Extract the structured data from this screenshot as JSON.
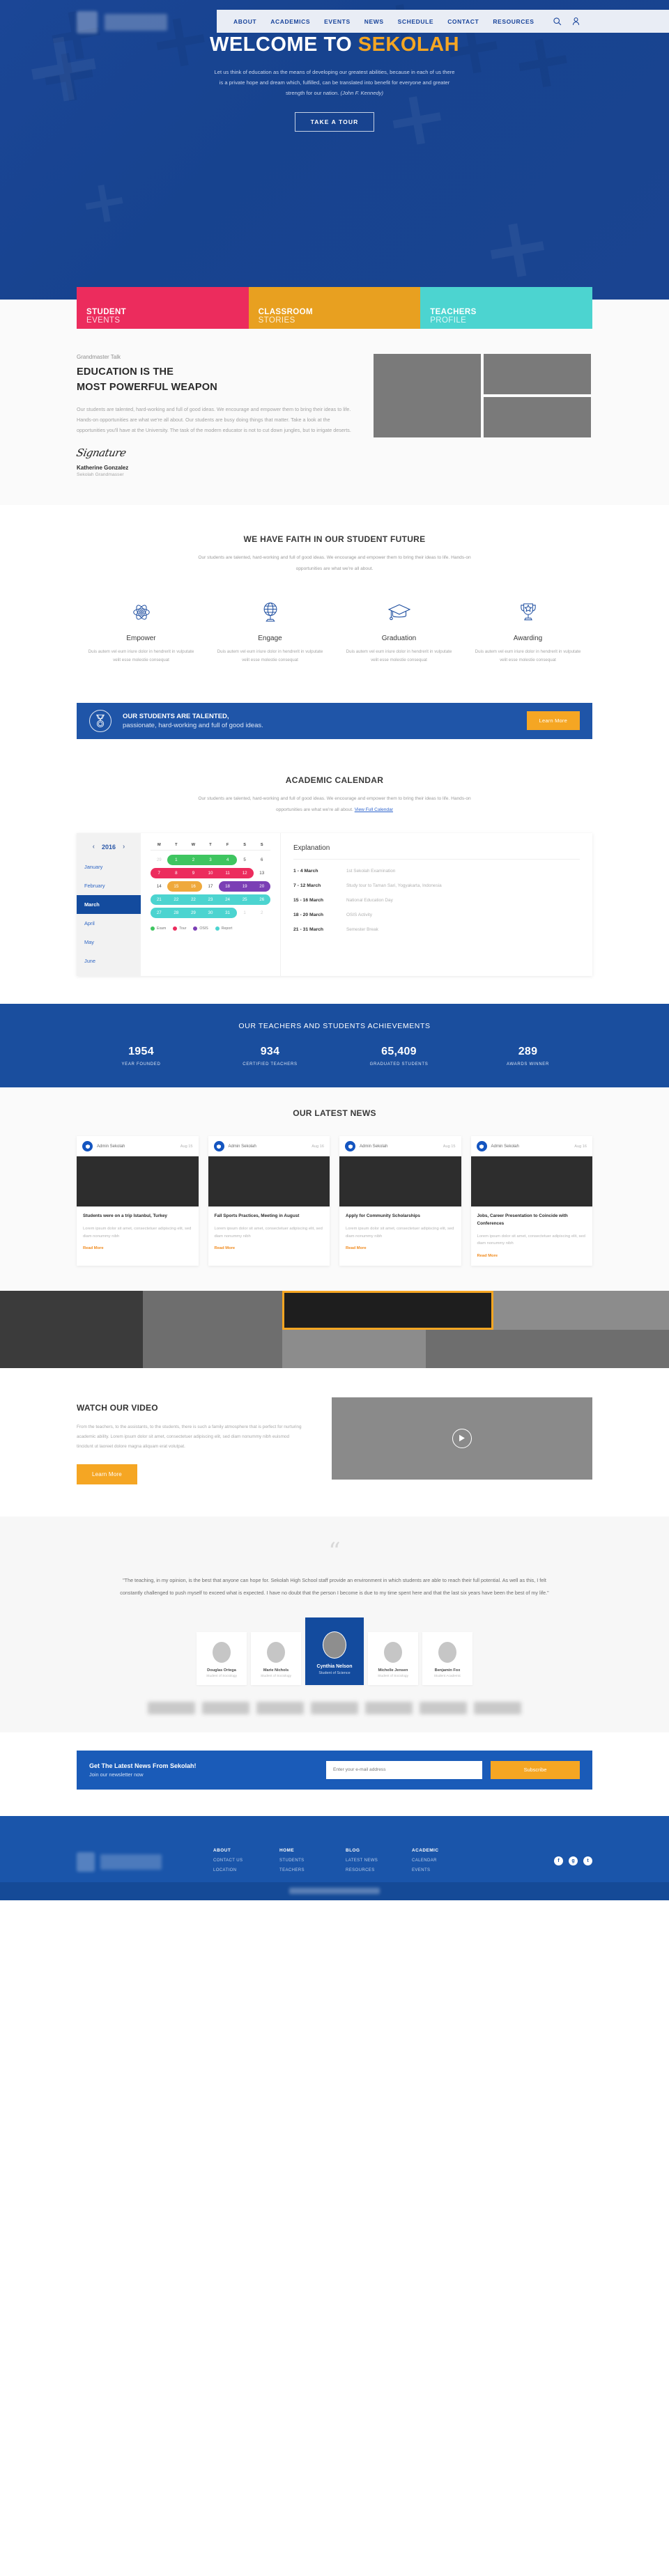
{
  "nav": {
    "items": [
      "ABOUT",
      "ACADEMICS",
      "EVENTS",
      "NEWS",
      "SCHEDULE",
      "CONTACT",
      "RESOURCES"
    ],
    "search_icon": "search-icon",
    "account_icon": "user-icon"
  },
  "hero": {
    "title_plain": "WELCOME TO ",
    "title_accent": "SEKOLAH",
    "paragraph": "Let us think of education as the means of developing our greatest abilities, because in each of us there is a private hope and dream which, fulfilled, can be translated into benefit for everyone and greater strength for our nation. ",
    "attribution": "(John F. Kennedy)",
    "cta": "TAKE A TOUR"
  },
  "cards3": [
    {
      "top": "STUDENT",
      "bottom": "EVENTS",
      "color": "#ec2c5d"
    },
    {
      "top": "CLASSROOM",
      "bottom": "STORIES",
      "color": "#e8a020"
    },
    {
      "top": "TEACHERS",
      "bottom": "PROFILE",
      "color": "#4cd4d0"
    }
  ],
  "grandmaster": {
    "eyebrow": "Grandmaster Talk",
    "title_line1": "EDUCATION IS THE",
    "title_line2": "MOST POWERFUL WEAPON",
    "body": "Our students are talented, hard-working and full of good ideas. We encourage and empower them to bring their ideas to life. Hands-on opportunities are what we're all about. Our students are busy doing things that matter. Take a look at the opportunities you'll have at the University. The task of the modern educator is not to cut down jungles, but to irrigate deserts.",
    "signature": "Signature",
    "name": "Katherine Gonzalez",
    "role": "Sekolah Grandmasser"
  },
  "faith": {
    "title": "WE HAVE FAITH IN OUR STUDENT FUTURE",
    "subtitle": "Our students are talented, hard-working and full of good ideas. We encourage and empower them to bring their ideas to life. Hands-on opportunities are what we're all about.",
    "features": [
      {
        "icon": "atom-icon",
        "name": "Empower",
        "desc": "Duis autem vel eum iriure dolor in hendrerit in vulputate velit esse molestie consequat"
      },
      {
        "icon": "globe-icon",
        "name": "Engage",
        "desc": "Duis autem vel eum iriure dolor in hendrerit in vulputate velit esse molestie consequat"
      },
      {
        "icon": "graduation-cap-icon",
        "name": "Graduation",
        "desc": "Duis autem vel eum iriure dolor in hendrerit in vulputate velit esse molestie consequat"
      },
      {
        "icon": "trophy-icon",
        "name": "Awarding",
        "desc": "Duis autem vel eum iriure dolor in hendrerit in vulputate velit esse molestie consequat"
      }
    ]
  },
  "talented": {
    "icon": "medal-icon",
    "line1": "OUR STUDENTS ARE TALENTED,",
    "line2": "passionate, hard-working and full of good ideas.",
    "button": "Learn More"
  },
  "calendar": {
    "title": "ACADEMIC CALENDAR",
    "subtitle": "Our students are talented, hard-working and full of good ideas. We encourage and empower them to bring their ideas to life. Hands-on opportunities are what we're all about. ",
    "link": "View Full Calendar",
    "year": "2016",
    "prev_icon": "chevron-left-icon",
    "next_icon": "chevron-right-icon",
    "months": [
      "January",
      "February",
      "March",
      "April",
      "May",
      "June"
    ],
    "active_month": "March",
    "dow": [
      "M",
      "T",
      "W",
      "T",
      "F",
      "S",
      "S"
    ],
    "weeks": [
      [
        "29",
        "1",
        "2",
        "3",
        "4",
        "5",
        "6"
      ],
      [
        "7",
        "8",
        "9",
        "10",
        "11",
        "12",
        "13"
      ],
      [
        "14",
        "15",
        "16",
        "17",
        "18",
        "19",
        "20"
      ],
      [
        "21",
        "22",
        "22",
        "23",
        "24",
        "25",
        "26"
      ],
      [
        "27",
        "28",
        "29",
        "30",
        "31",
        "1",
        "2"
      ]
    ],
    "legend": [
      {
        "label": "Exam",
        "color": "#3fc560"
      },
      {
        "label": "Tour",
        "color": "#ec2c5d"
      },
      {
        "label": "OSIS",
        "color": "#7b3fb5"
      },
      {
        "label": "Report",
        "color": "#4cd4d0"
      }
    ],
    "explanation_title": "Explanation",
    "explanations": [
      {
        "date": "1 - 4 March",
        "desc": "1st Sekolah Examination"
      },
      {
        "date": "7 - 12 March",
        "desc": "Study tour to Taman Sari, Yogyakarta, Indonesia"
      },
      {
        "date": "15 - 16 March",
        "desc": "National Education Day"
      },
      {
        "date": "18 - 20 March",
        "desc": "OSIS Activity"
      },
      {
        "date": "21 - 31 March",
        "desc": "Semester Break"
      }
    ]
  },
  "achievements": {
    "title": "OUR TEACHERS AND STUDENTS ACHIEVEMENTS",
    "items": [
      {
        "number": "1954",
        "label": "YEAR FOUNDED"
      },
      {
        "number": "934",
        "label": "CERTIFIED TEACHERS"
      },
      {
        "number": "65,409",
        "label": "GRADUATED STUDENTS"
      },
      {
        "number": "289",
        "label": "AWARDS WINNER"
      }
    ]
  },
  "news": {
    "title": "OUR LATEST NEWS",
    "read_more": "Read More",
    "cards": [
      {
        "author": "Admin Sekolah",
        "date": "Aug 15",
        "title": "Students were on a trip Istanbul, Turkey",
        "desc": "Lorem ipsum dolor sit amet, consectetuer adipiscing elit, sed diam nonummy nibh"
      },
      {
        "author": "Admin Sekolah",
        "date": "Aug 16",
        "title": "Fall Sports Practices, Meeting in August",
        "desc": "Lorem ipsum dolor sit amet, consectetuer adipiscing elit, sed diam nonummy nibh"
      },
      {
        "author": "Admin Sekolah",
        "date": "Aug 15",
        "title": "Apply for Community Scholarships",
        "desc": "Lorem ipsum dolor sit amet, consectetuer adipiscing elit, sed diam nonummy nibh"
      },
      {
        "author": "Admin Sekolah",
        "date": "Aug 16",
        "title": "Jobs, Career Presentation to Coincide with Conferences",
        "desc": "Lorem ipsum dolor sit amet, consectetuer adipiscing elit, sed diam nonummy nibh"
      }
    ]
  },
  "video": {
    "title": "WATCH OUR VIDEO",
    "desc": "From the teachers, to the assistants, to the students, there is such a family atmosphere that is perfect for nurturing academic ability. Lorem ipsum dolor sit amet, consectetuer adipiscing elit, sed diam nonummy nibh euismod tincidunt ut laoreet dolore magna aliquam erat volutpat.",
    "button": "Learn More",
    "play_icon": "play-icon"
  },
  "testimonial": {
    "quote_icon": "quote-icon",
    "text": "\"The teaching, in my opinion, is the best that anyone can hope for. Sekolah High School staff provide an environment in which students are able to reach their full potential. As well as this, I felt constantly challenged to push myself to exceed what is expected. I have no doubt that the person I become is due to my time spent here and that the last six years have been the best of my life.\"",
    "people": [
      {
        "name": "Douglas Ortega",
        "role": "Student of Sociology",
        "active": false
      },
      {
        "name": "Marie Nichols",
        "role": "Student of Sociology",
        "active": false
      },
      {
        "name": "Cynthia Nelson",
        "role": "Student of Science",
        "active": true
      },
      {
        "name": "Michelle Jensen",
        "role": "Student of Sociology",
        "active": false
      },
      {
        "name": "Benjamin Fox",
        "role": "Student Academic",
        "active": false
      }
    ]
  },
  "newsletter": {
    "title": "Get The Latest News From Sekolah!",
    "subtitle": "Join our newsletter now",
    "placeholder": "Enter your e-mail address",
    "value": "",
    "button": "Subscribe"
  },
  "footer": {
    "columns": [
      {
        "heading": "ABOUT",
        "links": [
          "CONTACT US",
          "LOCATION"
        ]
      },
      {
        "heading": "HOME",
        "links": [
          "STUDENTS",
          "TEACHERS"
        ]
      },
      {
        "heading": "BLOG",
        "links": [
          "LATEST NEWS",
          "RESOURCES"
        ]
      },
      {
        "heading": "ACADEMIC",
        "links": [
          "CALENDAR",
          "EVENTS"
        ]
      }
    ],
    "social": [
      {
        "icon": "facebook-icon",
        "glyph": "f"
      },
      {
        "icon": "google-plus-icon",
        "glyph": "g"
      },
      {
        "icon": "twitter-icon",
        "glyph": "t"
      }
    ]
  },
  "colors": {
    "brand_blue": "#17439a",
    "accent_orange": "#f5a623",
    "pink": "#ec2c5d",
    "teal": "#4cd4d0"
  }
}
